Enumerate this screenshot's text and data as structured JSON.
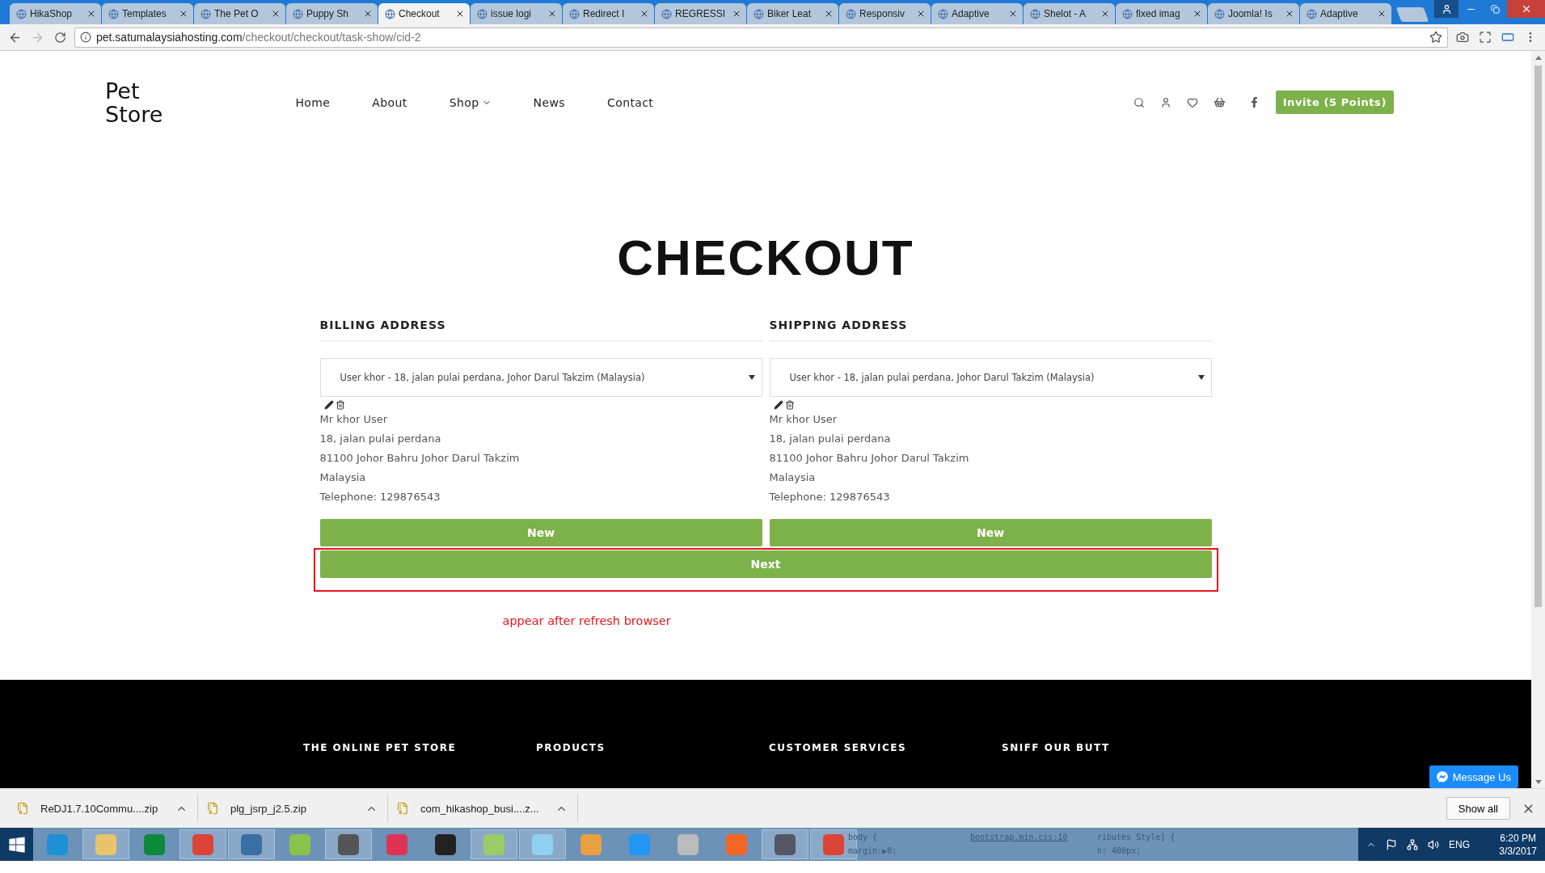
{
  "browser": {
    "tabs": [
      {
        "label": "HikaShop",
        "selected": false
      },
      {
        "label": "Templates",
        "selected": false
      },
      {
        "label": "The Pet O",
        "selected": false
      },
      {
        "label": "Puppy Sh",
        "selected": false
      },
      {
        "label": "Checkout",
        "selected": true
      },
      {
        "label": "issue logi",
        "selected": false
      },
      {
        "label": "Redirect I",
        "selected": false
      },
      {
        "label": "REGRESSI",
        "selected": false
      },
      {
        "label": "Biker Leat",
        "selected": false
      },
      {
        "label": "Responsiv",
        "selected": false
      },
      {
        "label": "Adaptive",
        "selected": false
      },
      {
        "label": "Shelot - A",
        "selected": false
      },
      {
        "label": "fixed imag",
        "selected": false
      },
      {
        "label": "Joomla! Is",
        "selected": false
      },
      {
        "label": "Adaptive",
        "selected": false
      }
    ],
    "url": {
      "host": "pet.satumalaysiahosting.com",
      "path": "/checkout/checkout/task-show/cid-2"
    }
  },
  "site": {
    "logo": [
      "Pet",
      "Store"
    ],
    "nav": [
      {
        "label": "Home",
        "has_menu": false
      },
      {
        "label": "About",
        "has_menu": false
      },
      {
        "label": "Shop",
        "has_menu": true
      },
      {
        "label": "News",
        "has_menu": false
      },
      {
        "label": "Contact",
        "has_menu": false
      }
    ],
    "invite_button": "Invite (5 Points)"
  },
  "page_title": "CHECKOUT",
  "addresses": [
    {
      "heading": "BILLING ADDRESS",
      "selected_option": "User khor - 18, jalan pulai perdana, Johor Darul Takzim (Malaysia)",
      "lines": [
        "Mr khor User",
        "18, jalan pulai perdana",
        "81100 Johor Bahru Johor Darul Takzim",
        "Malaysia",
        "Telephone: 129876543"
      ],
      "new_button": "New"
    },
    {
      "heading": "SHIPPING ADDRESS",
      "selected_option": "User khor - 18, jalan pulai perdana, Johor Darul Takzim (Malaysia)",
      "lines": [
        "Mr khor User",
        "18, jalan pulai perdana",
        "81100 Johor Bahru Johor Darul Takzim",
        "Malaysia",
        "Telephone: 129876543"
      ],
      "new_button": "New"
    }
  ],
  "next_button": "Next",
  "annotation": "appear after refresh browser",
  "footer": {
    "headings": [
      "THE ONLINE PET STORE",
      "PRODUCTS",
      "CUSTOMER SERVICES",
      "SNIFF OUR BUTT"
    ]
  },
  "message_button": "Message Us",
  "downloads": {
    "items": [
      "ReDJ1.7.10Commu....zip",
      "plg_jsrp_j2.5.zip",
      "com_hikashop_busi....z..."
    ],
    "show_all": "Show all"
  },
  "taskbar": {
    "apps": [
      {
        "open": false
      },
      {
        "open": true
      },
      {
        "open": false
      },
      {
        "open": true
      },
      {
        "open": true
      },
      {
        "open": false
      },
      {
        "open": true
      },
      {
        "open": false
      },
      {
        "open": false
      },
      {
        "open": true
      },
      {
        "open": true
      },
      {
        "open": false
      },
      {
        "open": false
      },
      {
        "open": false
      },
      {
        "open": false
      },
      {
        "open": true
      },
      {
        "open": true
      }
    ],
    "ghost_text": [
      {
        "lines": [
          "body {",
          "margin:▶0;"
        ]
      },
      {
        "lines": [
          "bootstrap.min.css:10"
        ]
      },
      {
        "lines": [
          "ributes Style] {",
          "h: 400px;"
        ]
      }
    ],
    "tray": {
      "language": "ENG",
      "time": "6:20 PM",
      "date": "3/3/2017"
    }
  }
}
